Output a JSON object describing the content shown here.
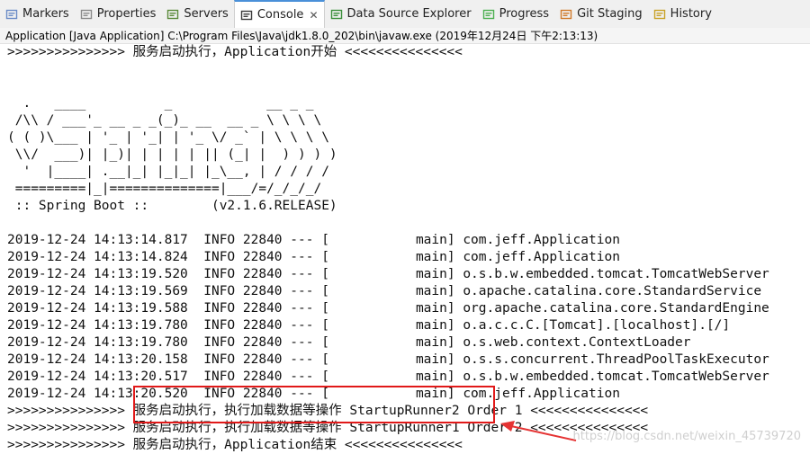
{
  "tabs": [
    {
      "label": "Markers",
      "icon": "markers-icon",
      "active": false
    },
    {
      "label": "Properties",
      "icon": "properties-icon",
      "active": false
    },
    {
      "label": "Servers",
      "icon": "servers-icon",
      "active": false
    },
    {
      "label": "Console",
      "icon": "console-icon",
      "active": true,
      "close": "✕"
    },
    {
      "label": "Data Source Explorer",
      "icon": "data-source-icon",
      "active": false
    },
    {
      "label": "Progress",
      "icon": "progress-icon",
      "active": false
    },
    {
      "label": "Git Staging",
      "icon": "git-staging-icon",
      "active": false
    },
    {
      "label": "History",
      "icon": "history-icon",
      "active": false
    }
  ],
  "console_title": "Application [Java Application] C:\\Program Files\\Java\\jdk1.8.0_202\\bin\\javaw.exe (2019年12月24日 下午2:13:13)",
  "lines": [
    ">>>>>>>>>>>>>>> 服务启动执行，Application开始 <<<<<<<<<<<<<<<",
    "",
    "",
    "  .   ____          _            __ _ _",
    " /\\\\ / ___'_ __ _ _(_)_ __  __ _ \\ \\ \\ \\",
    "( ( )\\___ | '_ | '_| | '_ \\/ _` | \\ \\ \\ \\",
    " \\\\/  ___)| |_)| | | | | || (_| |  ) ) ) )",
    "  '  |____| .__|_| |_|_| |_\\__, | / / / /",
    " =========|_|==============|___/=/_/_/_/",
    " :: Spring Boot ::        (v2.1.6.RELEASE)",
    "",
    "2019-12-24 14:13:14.817  INFO 22840 --- [           main] com.jeff.Application",
    "2019-12-24 14:13:14.824  INFO 22840 --- [           main] com.jeff.Application",
    "2019-12-24 14:13:19.520  INFO 22840 --- [           main] o.s.b.w.embedded.tomcat.TomcatWebServer",
    "2019-12-24 14:13:19.569  INFO 22840 --- [           main] o.apache.catalina.core.StandardService",
    "2019-12-24 14:13:19.588  INFO 22840 --- [           main] org.apache.catalina.core.StandardEngine",
    "2019-12-24 14:13:19.780  INFO 22840 --- [           main] o.a.c.c.C.[Tomcat].[localhost].[/]",
    "2019-12-24 14:13:19.780  INFO 22840 --- [           main] o.s.web.context.ContextLoader",
    "2019-12-24 14:13:20.158  INFO 22840 --- [           main] o.s.s.concurrent.ThreadPoolTaskExecutor",
    "2019-12-24 14:13:20.517  INFO 22840 --- [           main] o.s.b.w.embedded.tomcat.TomcatWebServer",
    "2019-12-24 14:13:20.520  INFO 22840 --- [           main] com.jeff.Application",
    ">>>>>>>>>>>>>>> 服务启动执行，执行加载数据等操作 StartupRunner2 Order 1 <<<<<<<<<<<<<<<",
    ">>>>>>>>>>>>>>> 服务启动执行，执行加载数据等操作 StartupRunner1 Order 2 <<<<<<<<<<<<<<<",
    ">>>>>>>>>>>>>>> 服务启动执行，Application结束 <<<<<<<<<<<<<<<"
  ],
  "watermark": "https://blog.csdn.net/weixin_45739720",
  "colors": {
    "highlight": "#e11919",
    "arrow": "#e53333",
    "tab_active_border": "#4a90d9"
  }
}
